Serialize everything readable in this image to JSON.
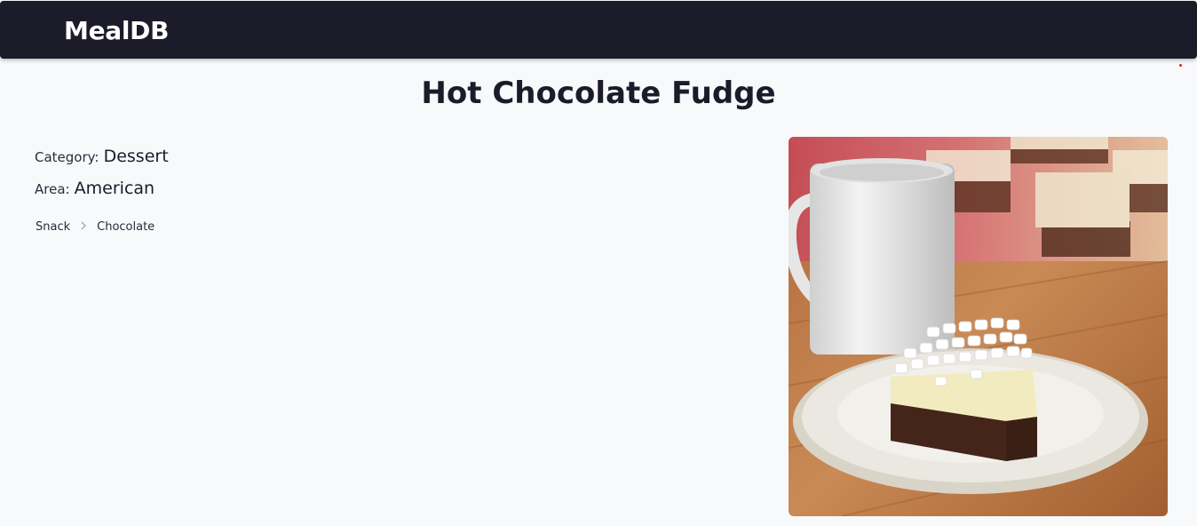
{
  "navbar": {
    "brand": "MealDB"
  },
  "meal": {
    "title": "Hot Chocolate Fudge",
    "category_label": "Category:",
    "category": "Dessert",
    "area_label": "Area:",
    "area": "American",
    "tags": [
      "Snack",
      "Chocolate"
    ],
    "image_alt": "Hot Chocolate Fudge"
  },
  "icons": {
    "tag_separator": "chevron-right-icon"
  },
  "colors": {
    "navbar_bg": "#1b1b2a",
    "page_bg": "#f8f9fb",
    "text": "#1b1b2a"
  }
}
